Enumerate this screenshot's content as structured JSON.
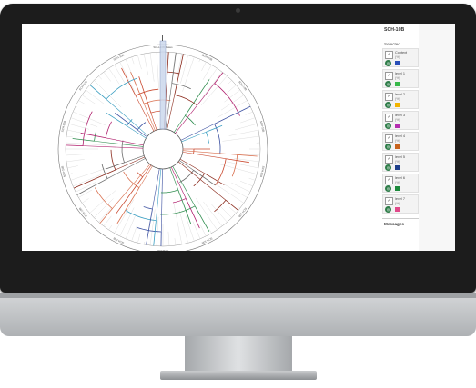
{
  "panel": {
    "title": "SCH-10B",
    "selected_label": "Selected",
    "messages_label": "Messages",
    "items": [
      {
        "name": "Context",
        "pct": "(%)",
        "color": "#2a4fb8"
      },
      {
        "name": "level 1",
        "pct": "(%)",
        "color": "#38b94a"
      },
      {
        "name": "level 2",
        "pct": "(%)",
        "color": "#f2b400"
      },
      {
        "name": "level 3",
        "pct": "(%)",
        "color": "#b52fb0"
      },
      {
        "name": "level 4",
        "pct": "(%)",
        "color": "#c8641e"
      },
      {
        "name": "level 5",
        "pct": "(%)",
        "color": "#1e3f8a"
      },
      {
        "name": "level 6",
        "pct": "(%)",
        "color": "#1d8a3c"
      },
      {
        "name": "level 7",
        "pct": "(%)",
        "color": "#e04a8a"
      }
    ]
  },
  "tree": {
    "ring_labels": [
      "SCH-10B Dates",
      "SCH-10B",
      "SCH-10B",
      "SCH-10B",
      "SCH-10B",
      "SCH-10B",
      "SCH-10B",
      "SCH-10B",
      "SCH-10B",
      "SCH-10B",
      "SCH-10B",
      "SCH-10B",
      "SCH-10B",
      "SCH-10B"
    ],
    "branch_colors": [
      "#c9472d",
      "#8b2a1c",
      "#2f8d4e",
      "#3a4fa0",
      "#d9704f",
      "#6b6b6b",
      "#b01f6d",
      "#3c9fc2"
    ]
  },
  "colors": {
    "accent": "#2f7d4a"
  }
}
